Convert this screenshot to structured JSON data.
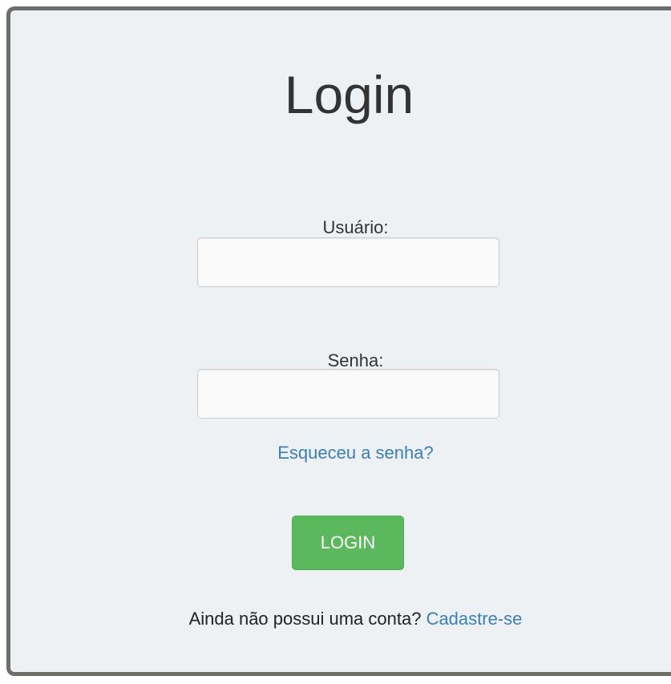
{
  "login_form": {
    "title": "Login",
    "username_label": "Usuário:",
    "username_value": "",
    "password_label": "Senha:",
    "password_value": "",
    "forgot_password_link": "Esqueceu a senha?",
    "submit_button": "LOGIN",
    "signup_prompt": "Ainda não possui uma conta?",
    "signup_link": "Cadastre-se"
  },
  "colors": {
    "panel_background": "#eef1f4",
    "panel_border": "#6c6e6a",
    "link": "#3b7fb8",
    "button": "#5cb85c",
    "button_text": "#ffffff",
    "text": "#333333"
  }
}
